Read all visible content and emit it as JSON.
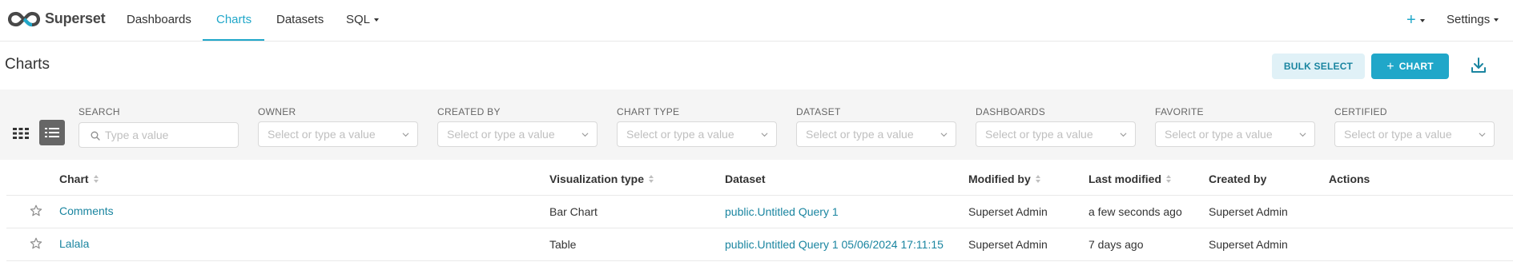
{
  "app": {
    "brand": "Superset",
    "nav": [
      {
        "label": "Dashboards",
        "active": false
      },
      {
        "label": "Charts",
        "active": true
      },
      {
        "label": "Datasets",
        "active": false
      },
      {
        "label": "SQL",
        "active": false
      }
    ],
    "plus_label": "+",
    "settings_label": "Settings",
    "accent_color": "#20a7c9"
  },
  "header": {
    "title": "Charts",
    "bulk_select_label": "BULK SELECT",
    "add_chart_label": "CHART",
    "add_chart_icon": "plus-icon",
    "download_icon": "download-icon"
  },
  "filters": {
    "search": {
      "label": "SEARCH",
      "placeholder": "Type a value"
    },
    "items": [
      {
        "label": "OWNER",
        "placeholder": "Select or type a value"
      },
      {
        "label": "CREATED BY",
        "placeholder": "Select or type a value"
      },
      {
        "label": "CHART TYPE",
        "placeholder": "Select or type a value"
      },
      {
        "label": "DATASET",
        "placeholder": "Select or type a value"
      },
      {
        "label": "DASHBOARDS",
        "placeholder": "Select or type a value"
      },
      {
        "label": "FAVORITE",
        "placeholder": "Select or type a value"
      },
      {
        "label": "CERTIFIED",
        "placeholder": "Select or type a value"
      }
    ]
  },
  "table": {
    "columns": [
      "Chart",
      "Visualization type",
      "Dataset",
      "Modified by",
      "Last modified",
      "Created by",
      "Actions"
    ],
    "rows": [
      {
        "chart": "Comments",
        "viz_type": "Bar Chart",
        "dataset": "public.Untitled Query 1",
        "modified_by": "Superset Admin",
        "last_modified": "a few seconds ago",
        "created_by": "Superset Admin"
      },
      {
        "chart": "Lalala",
        "viz_type": "Table",
        "dataset": "public.Untitled Query 1 05/06/2024 17:11:15",
        "modified_by": "Superset Admin",
        "last_modified": "7 days ago",
        "created_by": "Superset Admin"
      }
    ]
  }
}
